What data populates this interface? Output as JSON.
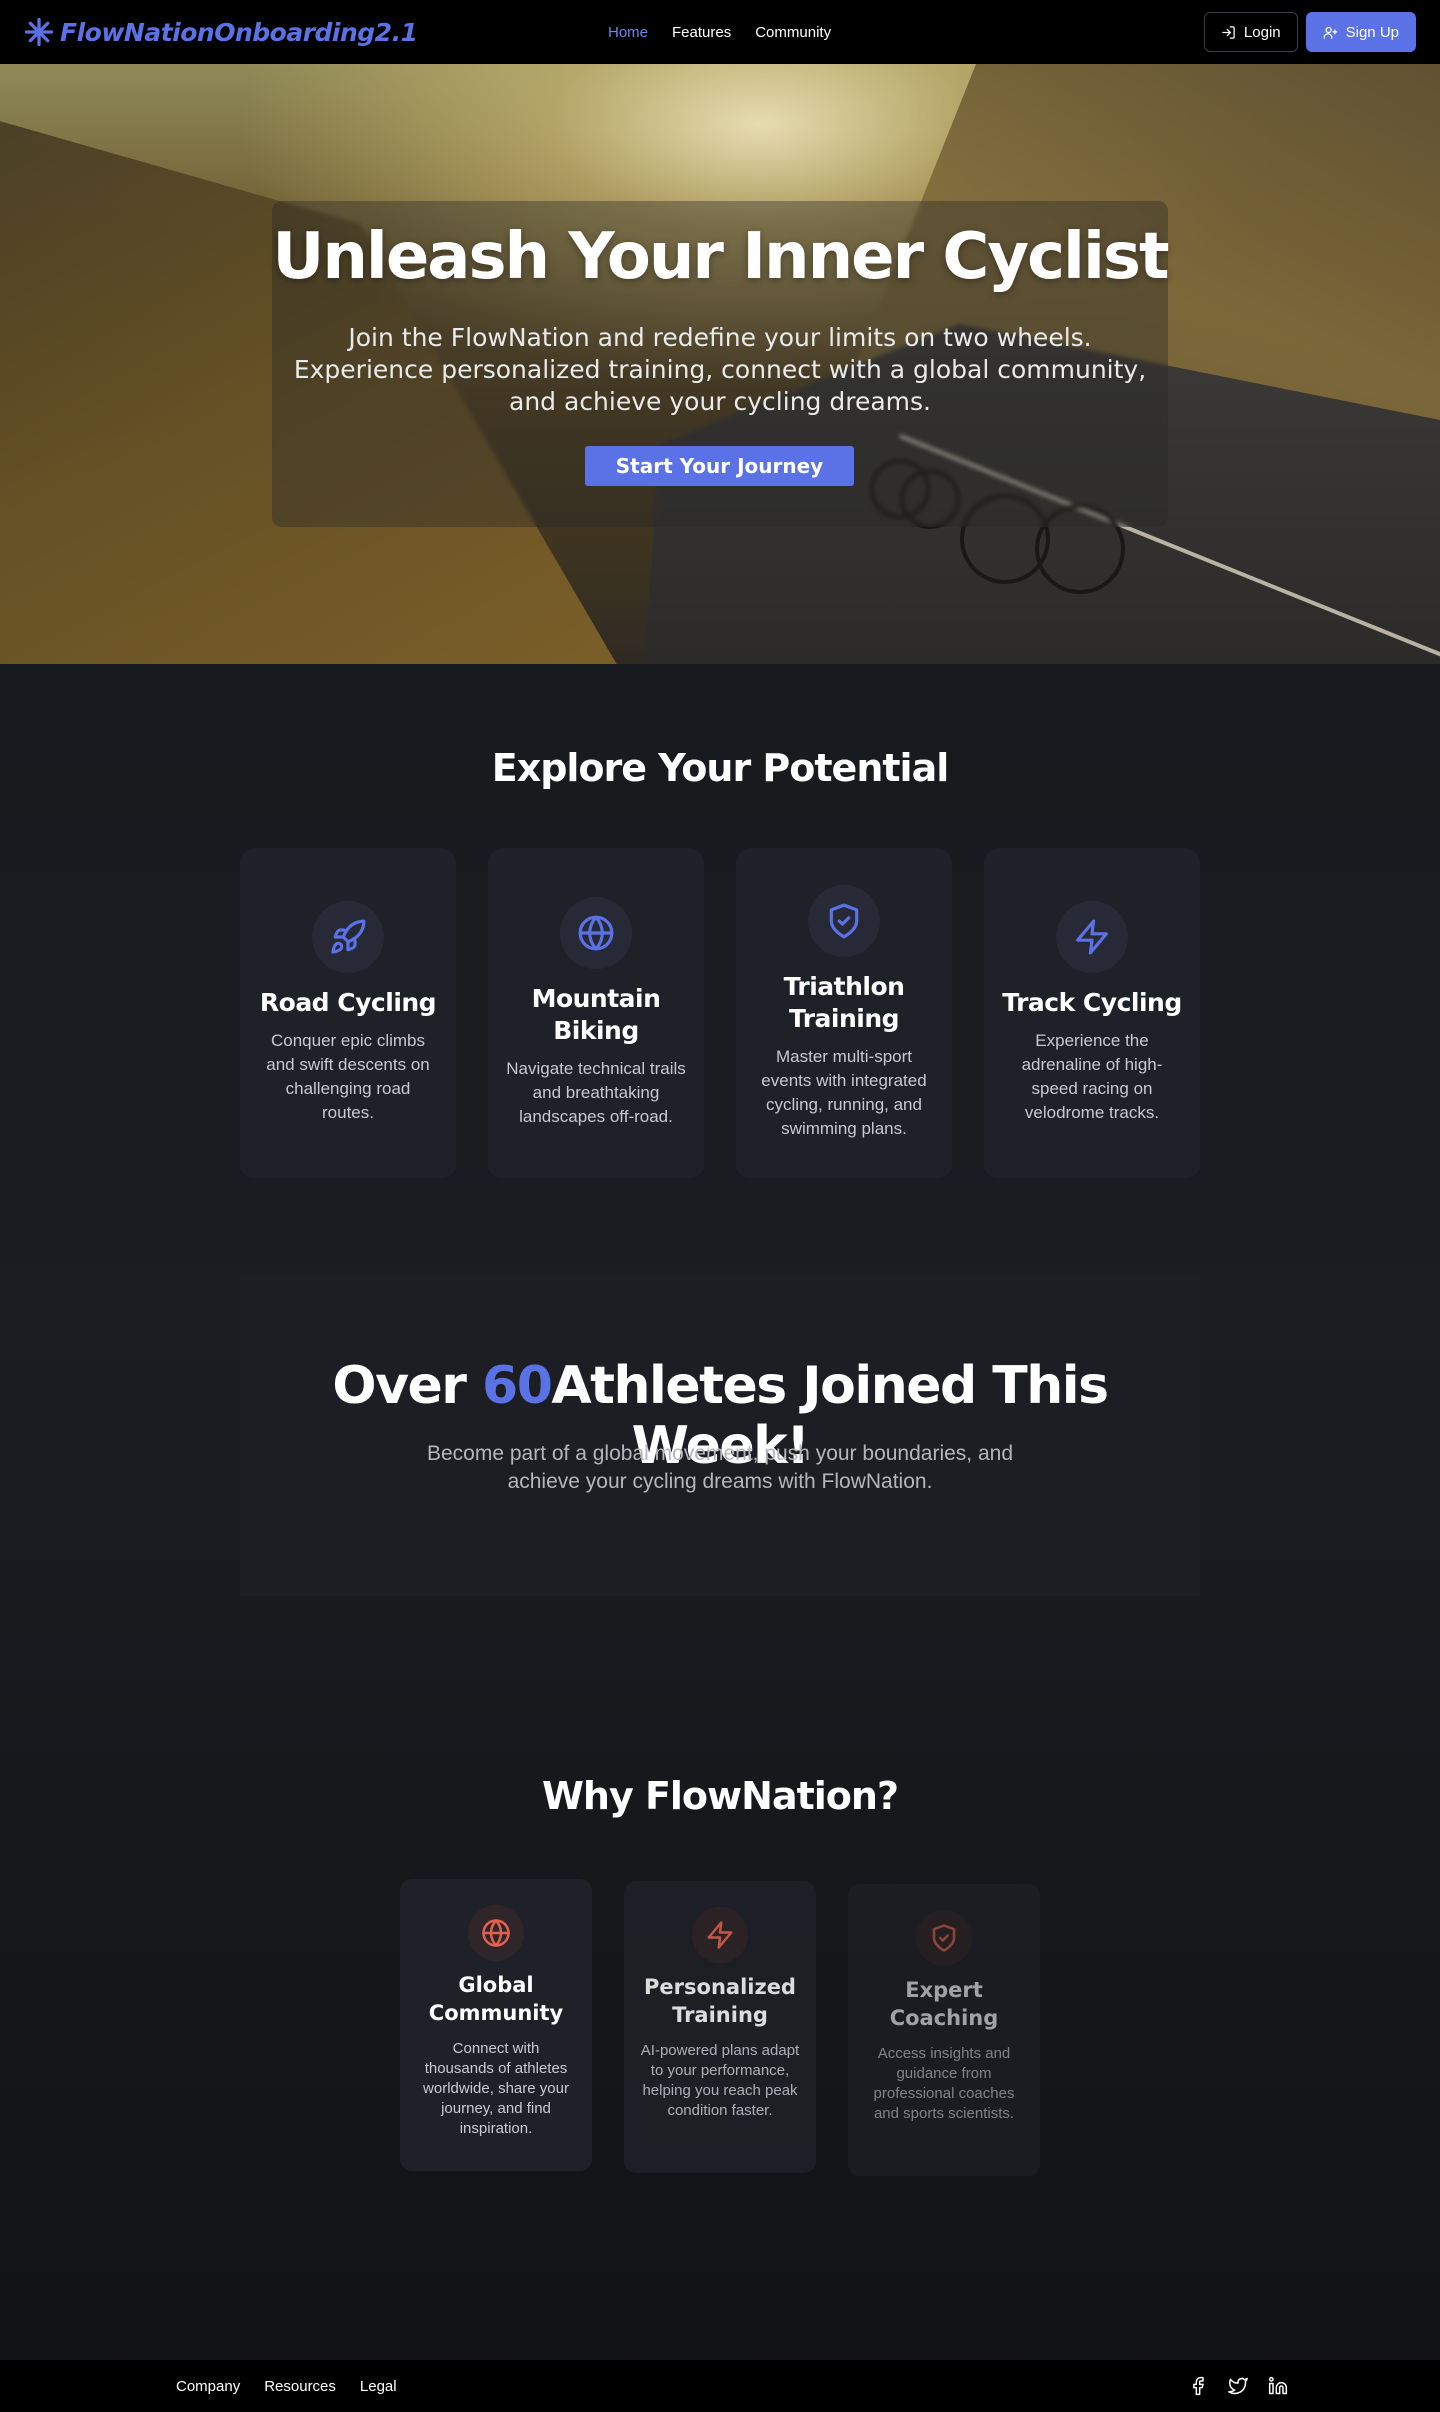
{
  "nav": {
    "brand": "FlowNationOnboarding2.1",
    "links": [
      "Home",
      "Features",
      "Community"
    ],
    "login_label": "Login",
    "signup_label": "Sign Up"
  },
  "hero": {
    "title": "Unleash Your Inner Cyclist",
    "subtitle": "Join the FlowNation and redefine your limits on two wheels. Experience personalized training, connect with a global community, and achieve your cycling dreams.",
    "cta": "Start Your Journey"
  },
  "explore": {
    "title": "Explore Your Potential",
    "cards": [
      {
        "icon": "rocket-icon",
        "title": "Road Cycling",
        "desc": "Conquer epic climbs and swift descents on challenging road routes."
      },
      {
        "icon": "globe-icon",
        "title": "Mountain Biking",
        "desc": "Navigate technical trails and breathtaking landscapes off-road."
      },
      {
        "icon": "shield-check-icon",
        "title": "Triathlon Training",
        "desc": "Master multi-sport events with integrated cycling, running, and swimming plans."
      },
      {
        "icon": "lightning-icon",
        "title": "Track Cycling",
        "desc": "Experience the adrenaline of high-speed racing on velodrome tracks."
      }
    ]
  },
  "stats": {
    "prefix": "Over ",
    "count": "60",
    "suffix": "Athletes Joined This Week!",
    "subtitle": "Become part of a global movement, push your boundaries, and achieve your cycling dreams with FlowNation."
  },
  "why": {
    "title": "Why FlowNation?",
    "cards": [
      {
        "icon": "globe-icon",
        "title": "Global Community",
        "desc": "Connect with thousands of athletes worldwide, share your journey, and find inspiration."
      },
      {
        "icon": "lightning-icon",
        "title": "Personalized Training",
        "desc": "AI-powered plans adapt to your performance, helping you reach peak condition faster."
      },
      {
        "icon": "shield-check-icon",
        "title": "Expert Coaching",
        "desc": "Access insights and guidance from professional coaches and sports scientists."
      }
    ]
  },
  "footer": {
    "links": [
      "Company",
      "Resources",
      "Legal"
    ],
    "social": [
      "facebook-icon",
      "twitter-icon",
      "linkedin-icon"
    ]
  },
  "colors": {
    "accent": "#5b72e6",
    "accent_light": "#6d86f0",
    "why_icon": "#e0634f",
    "card_bg": "#1f2128"
  }
}
